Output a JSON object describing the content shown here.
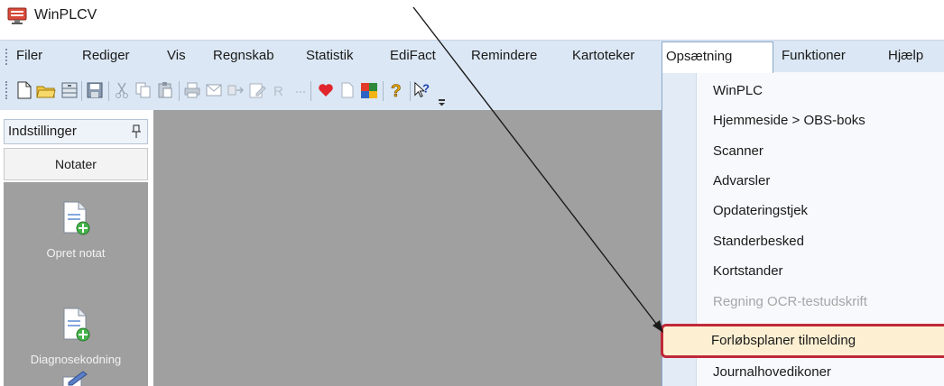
{
  "app": {
    "title": "WinPLCV"
  },
  "menubar": {
    "items": [
      "Filer",
      "Rediger",
      "Vis",
      "Regnskab",
      "Statistik",
      "EdiFact",
      "Remindere",
      "Kartoteker",
      "Opsætning",
      "Funktioner",
      "Hjælp"
    ],
    "open_item": "Opsætning"
  },
  "toolbar": {
    "icons": [
      "new-icon",
      "open-folder-icon",
      "cabinet-icon",
      "save-icon",
      "cut-icon",
      "copy-icon",
      "paste-icon",
      "print-icon",
      "mail-icon",
      "move-icon",
      "edit-icon",
      "r-icon",
      "heart-icon",
      "blank-doc-icon",
      "colored-book-icon",
      "help-icon",
      "whats-this-icon"
    ]
  },
  "left_panel": {
    "header": "Indstillinger",
    "tab": "Notater",
    "buttons": [
      "Opret notat",
      "Diagnosekodning"
    ]
  },
  "dropdown": {
    "items": [
      {
        "label": "WinPLC",
        "enabled": true
      },
      {
        "label": "Hjemmeside > OBS-boks",
        "enabled": true
      },
      {
        "label": "Scanner",
        "enabled": true
      },
      {
        "label": "Advarsler",
        "enabled": true
      },
      {
        "label": "Opdateringstjek",
        "enabled": true
      },
      {
        "label": "Standerbesked",
        "enabled": true
      },
      {
        "label": "Kortstander",
        "enabled": true
      },
      {
        "label": "Regning OCR-testudskrift",
        "enabled": false
      },
      {
        "label": "Forløbsplaner tilmelding",
        "enabled": true,
        "highlighted": true
      },
      {
        "label": "Journalhovedikoner",
        "enabled": true
      }
    ]
  },
  "colors": {
    "menubar_bg": "#dbe7f4",
    "work_area": "#a0a0a0",
    "highlight_border": "#c0283a",
    "highlight_fill": "#fdf0d2"
  }
}
